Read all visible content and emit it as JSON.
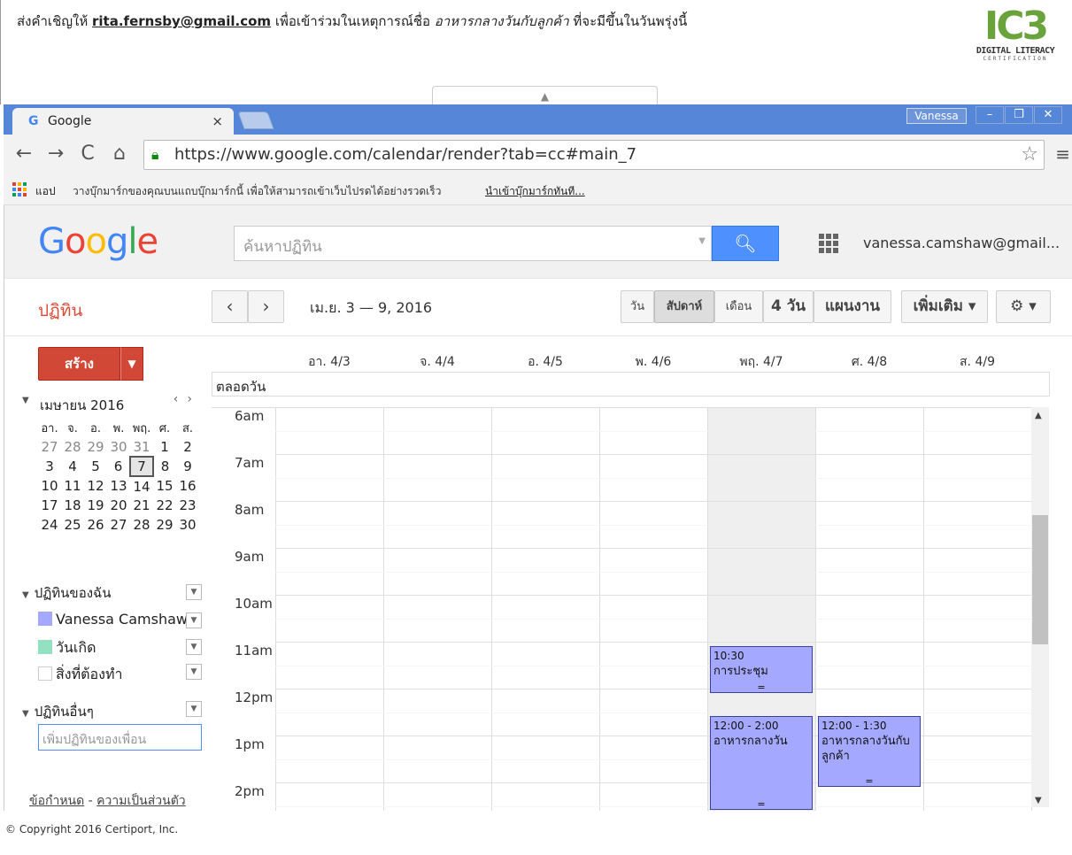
{
  "instruction": {
    "part1": "ส่งคำเชิญให้ ",
    "email": "rita.fernsby@gmail.com",
    "part2": " เพื่อเข้าร่วมในเหตุการณ์ชื่อ ",
    "event_name": "อาหารกลางวันกับลูกค้า",
    "part3": " ที่จะมีขึ้นในวันพรุ่งนี้"
  },
  "logo": {
    "main": "IC3",
    "line1": "DIGITAL LITERACY",
    "line2": "CERTIFICATION"
  },
  "browser": {
    "tab_title": "Google",
    "tab_close": "×",
    "user_chip": "Vanessa",
    "url": "https://www.google.com/calendar/render?tab=cc#main_7",
    "apps_label": "แอป",
    "bookmarks_text": "วางบุ๊กมาร์กของคุณบนแถบบุ๊กมาร์กนี้ เพื่อให้สามารถเข้าเว็บไปรดได้อย่างรวดเร็ว",
    "bookmarks_link": "นำเข้าบุ๊กมาร์กทันที..."
  },
  "header": {
    "search_placeholder": "ค้นหาปฏิทิน",
    "account": "vanessa.camshaw@gmail..."
  },
  "toolbar": {
    "title": "ปฏิทิน",
    "prev": "‹",
    "next": "›",
    "date_range": "เม.ย. 3 — 9, 2016",
    "views": [
      "วัน",
      "สัปดาห์",
      "เดือน",
      "4 วัน",
      "แผนงาน"
    ],
    "more": "เพิ่มเติม ▾",
    "settings": "⚙ ▾"
  },
  "sidebar": {
    "create": "สร้าง",
    "create_dd": "▼",
    "month": "เมษายน 2016",
    "dow": [
      "อา.",
      "จ.",
      "อ.",
      "พ.",
      "พฤ.",
      "ศ.",
      "ส."
    ],
    "weeks": [
      [
        "27",
        "28",
        "29",
        "30",
        "31",
        "1",
        "2"
      ],
      [
        "3",
        "4",
        "5",
        "6",
        "7",
        "8",
        "9"
      ],
      [
        "10",
        "11",
        "12",
        "13",
        "14",
        "15",
        "16"
      ],
      [
        "17",
        "18",
        "19",
        "20",
        "21",
        "22",
        "23"
      ],
      [
        "24",
        "25",
        "26",
        "27",
        "28",
        "29",
        "30"
      ]
    ],
    "my_cal_title": "ปฏิทินของฉัน",
    "my_cals": [
      {
        "name": "Vanessa Camshaw",
        "color": "#a4a8ff"
      },
      {
        "name": "วันเกิด",
        "color": "#92e1c0"
      },
      {
        "name": "สิ่งที่ต้องทำ",
        "color": "#ffffff"
      }
    ],
    "other_cal_title": "ปฏิทินอื่นๆ",
    "add_friend_placeholder": "เพิ่มปฏิทินของเพื่อน",
    "terms": "ข้อกำหนด",
    "sep": " - ",
    "privacy": "ความเป็นส่วนตัว"
  },
  "week": {
    "all_day": "ตลอดวัน",
    "days": [
      "อา. 4/3",
      "จ. 4/4",
      "อ. 4/5",
      "พ. 4/6",
      "พฤ. 4/7",
      "ศ. 4/8",
      "ส. 4/9"
    ],
    "hours": [
      "6am",
      "7am",
      "8am",
      "9am",
      "10am",
      "11am",
      "12pm",
      "1pm",
      "2pm"
    ],
    "events": [
      {
        "time": "10:30",
        "title": "การประชุม",
        "day": "พฤ. 4/7"
      },
      {
        "time": "12:00 - 2:00",
        "title": "อาหารกลางวัน",
        "day": "พฤ. 4/7"
      },
      {
        "time": "12:00 - 1:30",
        "title": "อาหารกลางวันกับลูกค้า",
        "day": "ศ. 4/8"
      }
    ]
  },
  "copyright": "© Copyright 2016 Certiport, Inc."
}
